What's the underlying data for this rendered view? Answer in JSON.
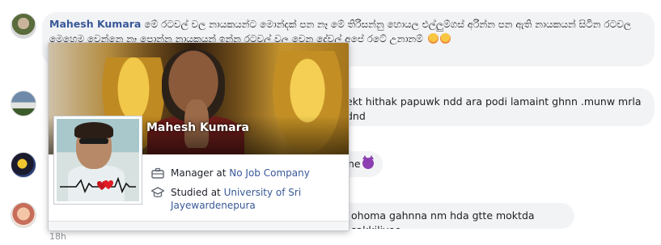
{
  "comments": [
    {
      "author": "Mahesh Kumara",
      "text": "මේ රටවල් වල නායකයන්ට මොන්දක් පන නෑ මේ තිරිසන්නු හොයල එල්ලුම්ගස් අරින්න පන ඇති නායකයන් සිටින රටවල මෙහෙම වෙන්නෙ නෑ පොන්න නායකයන් ඉන්න රටවල් වල වෙන දේවල් අපේ රටේ උනානම්",
      "emoji": [
        "angry-emoji",
        "angry-emoji"
      ]
    },
    {
      "text_visible": "ekt hithak papuwk ndd ara podi lamaint ghnn .munw mrla dnd"
    },
    {
      "text_visible": "ne",
      "emoji": [
        "devil-emoji"
      ]
    },
    {
      "text_visible": "ohoma gahnna nm hda gtte moktda sakkiliyoo"
    }
  ],
  "timestamp": "18h",
  "hovercard": {
    "name": "Mahesh Kumara",
    "work_prefix": "Manager at ",
    "work_place": "No Job Company",
    "study_prefix": "Studied at ",
    "study_place": "University of Sri Jayewardenepura",
    "work_icon": "briefcase-icon",
    "study_icon": "graduation-cap-icon"
  },
  "colors": {
    "link": "#385898",
    "bubble": "#f2f3f5",
    "muted": "#90949c"
  }
}
